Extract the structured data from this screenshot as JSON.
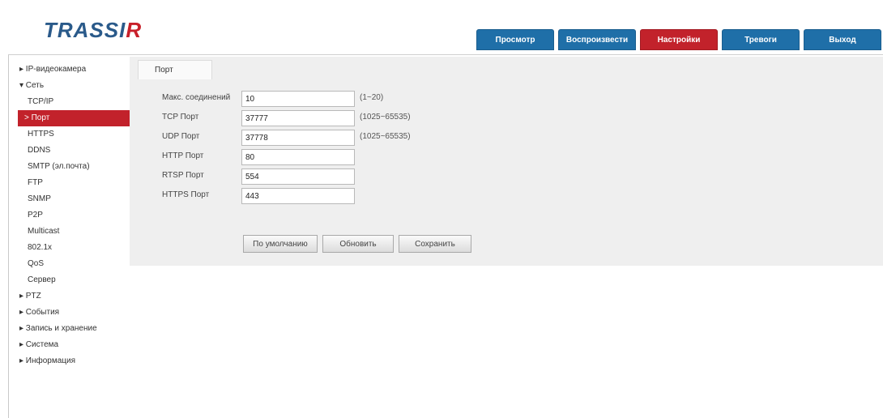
{
  "app": {
    "logo_main": "TRASSI",
    "logo_accent": "R"
  },
  "topnav": [
    {
      "label": "Просмотр"
    },
    {
      "label": "Воспроизвести"
    },
    {
      "label": "Настройки"
    },
    {
      "label": "Тревоги"
    },
    {
      "label": "Выход"
    }
  ],
  "sidebar": {
    "items": [
      {
        "label": "▸ IP-видеокамера",
        "level": 1
      },
      {
        "label": "▾ Сеть",
        "level": 1
      },
      {
        "label": "TCP/IP",
        "level": 2
      },
      {
        "label": "> Порт",
        "level": 2,
        "active": true
      },
      {
        "label": "HTTPS",
        "level": 2
      },
      {
        "label": "DDNS",
        "level": 2
      },
      {
        "label": "SMTP (эл.почта)",
        "level": 2
      },
      {
        "label": "FTP",
        "level": 2
      },
      {
        "label": "SNMP",
        "level": 2
      },
      {
        "label": "P2P",
        "level": 2
      },
      {
        "label": "Multicast",
        "level": 2
      },
      {
        "label": "802.1x",
        "level": 2
      },
      {
        "label": "QoS",
        "level": 2
      },
      {
        "label": "Сервер",
        "level": 2
      },
      {
        "label": "▸ PTZ",
        "level": 1
      },
      {
        "label": "▸ События",
        "level": 1
      },
      {
        "label": "▸ Запись и хранение",
        "level": 1
      },
      {
        "label": "▸ Система",
        "level": 1
      },
      {
        "label": "▸ Информация",
        "level": 1
      }
    ]
  },
  "tab": {
    "label": "Порт"
  },
  "form": {
    "rows": [
      {
        "label": "Макс. соединений",
        "value": "10",
        "hint": "(1~20)"
      },
      {
        "label": "TCP Порт",
        "value": "37777",
        "hint": "(1025~65535)"
      },
      {
        "label": "UDP Порт",
        "value": "37778",
        "hint": "(1025~65535)"
      },
      {
        "label": "HTTP Порт",
        "value": "80",
        "hint": ""
      },
      {
        "label": "RTSP Порт",
        "value": "554",
        "hint": ""
      },
      {
        "label": "HTTPS Порт",
        "value": "443",
        "hint": ""
      }
    ],
    "buttons": {
      "default": "По умолчанию",
      "refresh": "Обновить",
      "save": "Сохранить"
    }
  },
  "colors": {
    "nav_blue": "#1f6fa8",
    "accent_red": "#c2222b",
    "panel_bg": "#efefef"
  }
}
